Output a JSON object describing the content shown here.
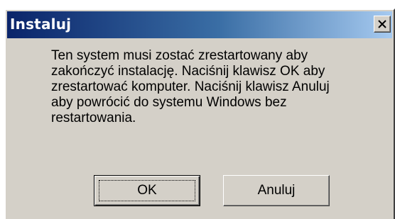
{
  "window": {
    "title": "Instaluj",
    "close_icon": "close-x-icon"
  },
  "message": {
    "text": "Ten system musi zostać zrestartowany aby\nzakończyć instalację. Naciśnij klawisz OK aby\nzrestartować komputer. Naciśnij klawisz Anuluj\naby powrócić do systemu Windows bez\nrestartowania."
  },
  "buttons": {
    "ok_label": "OK",
    "cancel_label": "Anuluj"
  },
  "colors": {
    "title_bar_start": "#0a246a",
    "title_bar_end": "#a6caf0",
    "dialog_face": "#d4d0c8"
  }
}
